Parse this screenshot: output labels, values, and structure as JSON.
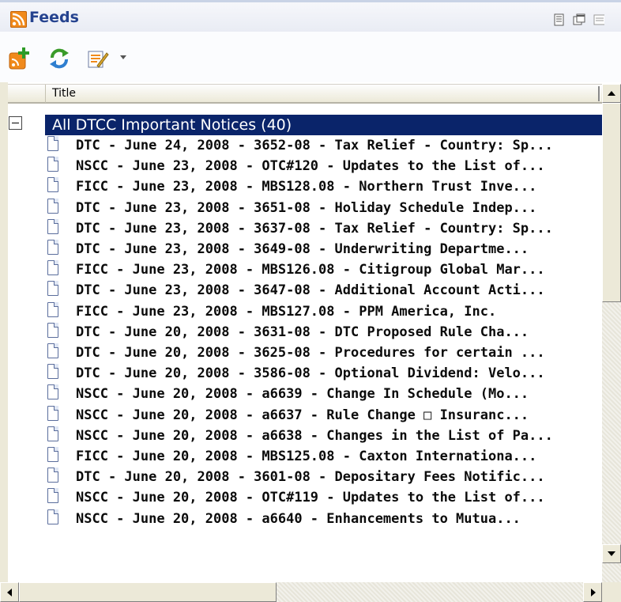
{
  "panel": {
    "title": "Feeds",
    "title_icon": "rss-feed-icon",
    "header_buttons": [
      "panel-options-icon",
      "panel-restore-icon",
      "panel-close-icon"
    ]
  },
  "toolbar": {
    "buttons": [
      {
        "name": "add-feed-button",
        "icon": "add-feed-icon"
      },
      {
        "name": "refresh-feeds-button",
        "icon": "refresh-icon"
      },
      {
        "name": "feed-properties-button",
        "icon": "edit-feed-icon"
      }
    ]
  },
  "column": {
    "title": "Title"
  },
  "tree": {
    "root": {
      "label": "All DTCC Important Notices (40)",
      "expanded": true
    },
    "items": [
      "DTC - June 24, 2008 - 3652-08 - Tax Relief - Country: Sp...",
      "NSCC - June 23, 2008 - OTC#120 - Updates to the List of...",
      "FICC - June 23, 2008 - MBS128.08 - Northern Trust Inve...",
      "DTC - June 23, 2008 - 3651-08 - Holiday Schedule Indep...",
      "DTC - June 23, 2008 - 3637-08 - Tax Relief - Country: Sp...",
      "DTC - June 23, 2008 - 3649-08 - Underwriting Departme...",
      "FICC - June 23, 2008 - MBS126.08 - Citigroup Global Mar...",
      "DTC - June 23, 2008 - 3647-08 - Additional Account Acti...",
      "FICC - June 23, 2008 - MBS127.08 - PPM America, Inc.",
      "DTC - June 20, 2008 - 3631-08 - DTC Proposed Rule Cha...",
      "DTC - June 20, 2008 - 3625-08 - Procedures for certain ...",
      "DTC - June 20, 2008 - 3586-08 - Optional Dividend: Velo...",
      "NSCC - June 20, 2008 - a6639 - Change In Schedule (Mo...",
      "NSCC - June 20, 2008 - a6637 - Rule Change □ Insuranc...",
      "NSCC - June 20, 2008 - a6638 - Changes in the List of Pa...",
      "FICC - June 20, 2008 - MBS125.08 - Caxton Internationa...",
      "DTC - June 20, 2008 - 3601-08 - Depositary Fees Notific...",
      "NSCC - June 20, 2008 - OTC#119 - Updates to the List of...",
      "NSCC - June 20, 2008 - a6640 - Enhancements to Mutua..."
    ]
  },
  "colors": {
    "selection": "#0a246a",
    "title_text": "#25438f",
    "rss_orange": "#f08a1c"
  }
}
